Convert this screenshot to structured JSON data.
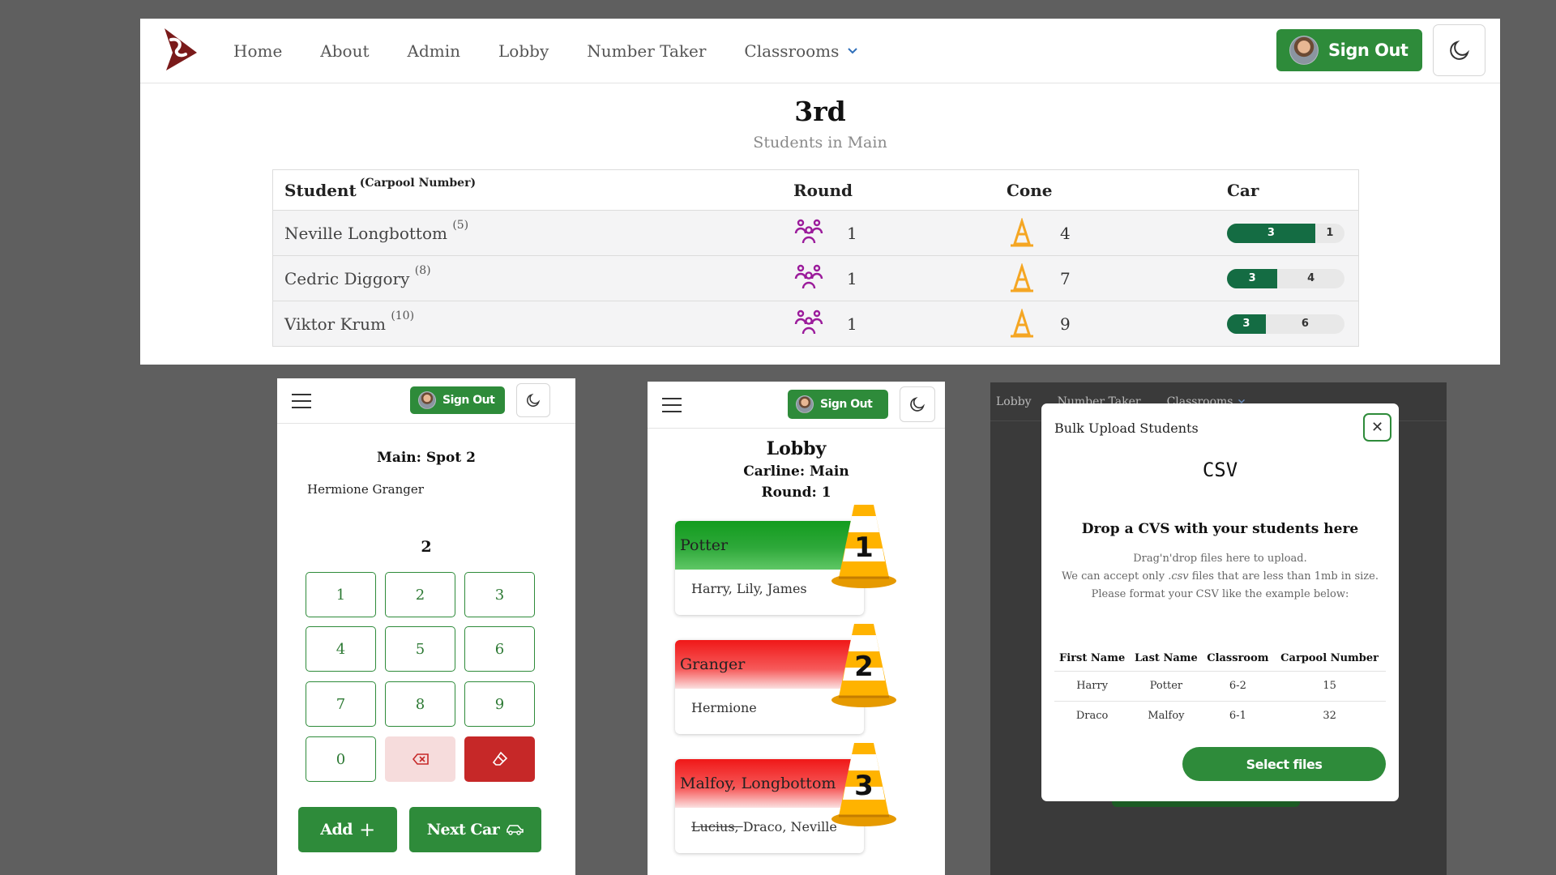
{
  "desktop": {
    "nav": {
      "links": [
        "Home",
        "About",
        "Admin",
        "Lobby",
        "Number Taker",
        "Classrooms"
      ],
      "sign_out": "Sign Out"
    },
    "title": "3rd",
    "subtitle": "Students in Main",
    "table": {
      "headers": {
        "student": "Student",
        "student_sup": "(Carpool Number)",
        "round": "Round",
        "cone": "Cone",
        "car": "Car"
      },
      "rows": [
        {
          "name": "Neville Longbottom",
          "carpool": "(5)",
          "round": "1",
          "cone": "4",
          "car_fill": "3",
          "car_rest": "1",
          "car_pct": 0.75
        },
        {
          "name": "Cedric Diggory",
          "carpool": "(8)",
          "round": "1",
          "cone": "7",
          "car_fill": "3",
          "car_rest": "4",
          "car_pct": 0.43
        },
        {
          "name": "Viktor Krum",
          "carpool": "(10)",
          "round": "1",
          "cone": "9",
          "car_fill": "3",
          "car_rest": "6",
          "car_pct": 0.33
        }
      ]
    }
  },
  "number_taker": {
    "sign_out": "Sign Out",
    "spot": "Main: Spot 2",
    "student": "Hermione Granger",
    "entry": "2",
    "keys": [
      "1",
      "2",
      "3",
      "4",
      "5",
      "6",
      "7",
      "8",
      "9",
      "0"
    ],
    "add": "Add",
    "next_car": "Next Car"
  },
  "lobby": {
    "sign_out": "Sign Out",
    "title": "Lobby",
    "carline": "Carline: Main",
    "round": "Round: 1",
    "cards": [
      {
        "family": "Potter",
        "members": "Harry, Lily, James",
        "struck": "",
        "cone": "1",
        "color": "#139c1e"
      },
      {
        "family": "Granger",
        "members": "Hermione",
        "struck": "",
        "cone": "2",
        "color": "#f01818"
      },
      {
        "family": "Malfoy, Longbottom",
        "members": "Draco, Neville",
        "struck": "Lucius, ",
        "cone": "3",
        "color": "#f01818"
      }
    ]
  },
  "bulk_upload": {
    "bg_nav": [
      "Lobby",
      "Number Taker",
      "Classrooms"
    ],
    "title": "Bulk Upload Students",
    "format": "CSV",
    "drop_heading": "Drop a CVS with your students here",
    "help_1": "Drag'n'drop files here to upload.",
    "help_2a": "We can accept only ",
    "help_2b": ".csv",
    "help_2c": " files that are less than 1mb in size.",
    "help_3": "Please format your CSV like the example below:",
    "columns": [
      "First Name",
      "Last Name",
      "Classroom",
      "Carpool Number"
    ],
    "rows": [
      [
        "Harry",
        "Potter",
        "6-2",
        "15"
      ],
      [
        "Draco",
        "Malfoy",
        "6-1",
        "32"
      ]
    ],
    "select_files": "Select files"
  },
  "colors": {
    "brand_green": "#2e8b3a",
    "danger_red": "#c62828",
    "round_purple": "#9b1b9b",
    "cone_orange": "#f5a623"
  }
}
